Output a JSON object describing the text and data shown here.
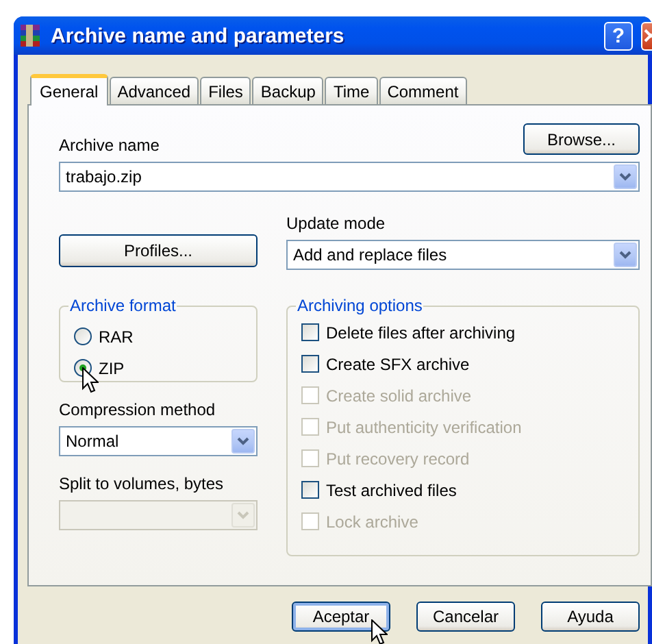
{
  "window": {
    "title": "Archive name and parameters",
    "help_button": "?"
  },
  "tabs": [
    {
      "label": "General",
      "selected": true
    },
    {
      "label": "Advanced",
      "selected": false
    },
    {
      "label": "Files",
      "selected": false
    },
    {
      "label": "Backup",
      "selected": false
    },
    {
      "label": "Time",
      "selected": false
    },
    {
      "label": "Comment",
      "selected": false
    }
  ],
  "archive_name": {
    "label": "Archive name",
    "value": "trabajo.zip"
  },
  "browse_button": "Browse...",
  "profiles_button": "Profiles...",
  "update_mode": {
    "label": "Update mode",
    "value": "Add and replace files"
  },
  "archive_format": {
    "title": "Archive format",
    "options": [
      {
        "label": "RAR",
        "selected": false
      },
      {
        "label": "ZIP",
        "selected": true
      }
    ]
  },
  "compression_method": {
    "label": "Compression method",
    "value": "Normal"
  },
  "split_volumes": {
    "label": "Split to volumes, bytes",
    "disabled": true
  },
  "archiving_options": {
    "title": "Archiving options",
    "options": [
      {
        "label": "Delete files after archiving",
        "checked": false,
        "disabled": false
      },
      {
        "label": "Create SFX archive",
        "checked": false,
        "disabled": false
      },
      {
        "label": "Create solid archive",
        "checked": false,
        "disabled": true
      },
      {
        "label": "Put authenticity verification",
        "checked": false,
        "disabled": true
      },
      {
        "label": "Put recovery record",
        "checked": false,
        "disabled": true
      },
      {
        "label": "Test archived files",
        "checked": false,
        "disabled": false
      },
      {
        "label": "Lock archive",
        "checked": false,
        "disabled": true
      }
    ]
  },
  "buttons": [
    {
      "label": "Aceptar",
      "default": true
    },
    {
      "label": "Cancelar",
      "default": false
    },
    {
      "label": "Ayuda",
      "default": false
    }
  ]
}
